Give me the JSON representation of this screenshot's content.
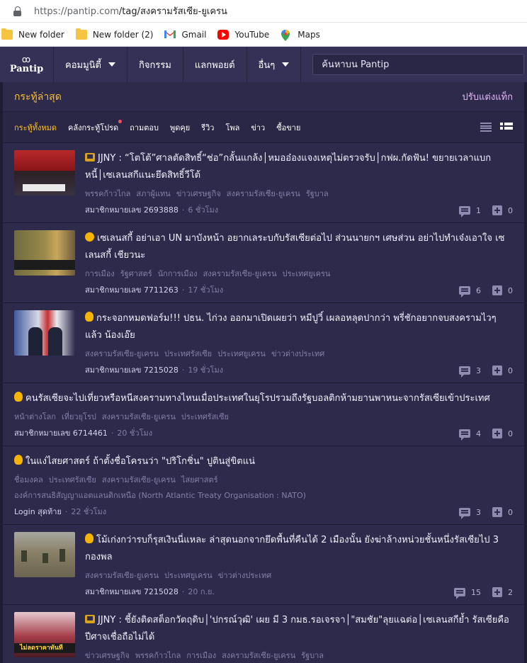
{
  "browser": {
    "url_base": "https://pantip.com",
    "url_path": "/tag/สงครามรัสเซีย-ยูเครน",
    "bookmarks": [
      {
        "label": "New folder",
        "icon": "folder-icon"
      },
      {
        "label": "New folder (2)",
        "icon": "folder-icon"
      },
      {
        "label": "Gmail",
        "icon": "gmail-icon"
      },
      {
        "label": "YouTube",
        "icon": "youtube-icon"
      },
      {
        "label": "Maps",
        "icon": "maps-icon"
      }
    ]
  },
  "nav": {
    "logo_text": "Pantip",
    "logo_mark": "ꝏ",
    "items": [
      {
        "label": "คอมมูนิตี้",
        "has_caret": true
      },
      {
        "label": "กิจกรรม",
        "has_caret": false
      },
      {
        "label": "แลกพอยต์",
        "has_caret": false
      },
      {
        "label": "อื่นๆ",
        "has_caret": true
      }
    ],
    "search_placeholder": "ค้นหาบน Pantip"
  },
  "section": {
    "title": "กระทู้ล่าสุด",
    "customize_label": "ปรับแต่งแท็ก"
  },
  "filters": [
    {
      "label": "กระทู้ทั้งหมด",
      "active": true,
      "dot": false
    },
    {
      "label": "คลังกระทู้โปรด",
      "active": false,
      "dot": true
    },
    {
      "label": "ถามตอบ",
      "active": false,
      "dot": false
    },
    {
      "label": "พูดคุย",
      "active": false,
      "dot": false
    },
    {
      "label": "รีวิว",
      "active": false,
      "dot": false
    },
    {
      "label": "โพล",
      "active": false,
      "dot": false
    },
    {
      "label": "ข่าว",
      "active": false,
      "dot": false
    },
    {
      "label": "ซื้อขาย",
      "active": false,
      "dot": false
    }
  ],
  "threads": [
    {
      "emoji": "tv",
      "thumb": "th1",
      "title": "JJNY : “โตโต้”ศาลตัดสิทธิ์“ช่อ”กลั้นแกล้ง│หมออ๋องแจงเหตุไม่ตรวจรับ│กฟผ.กัดฟัน! ขยายเวลาแบกหนี้│เซเลนสกีแนะยึดสิทธิ์วีโต้",
      "tags": [
        "พรรคก้าวไกล",
        "สภาผู้แทน",
        "ข่าวเศรษฐกิจ",
        "สงครามรัสเซีย-ยูเครน",
        "รัฐบาล"
      ],
      "author": "สมาชิกหมายเลข 2693888",
      "time": "6 ชั่วโมง",
      "comments": "1",
      "votes": "0"
    },
    {
      "emoji": "face",
      "thumb": "th2",
      "title": "เซเลนสกี้ อย่าเอา UN มาบังหน้า อยากเลระบกับรัสเซียต่อไป ส่วนนายกฯ เศษส่วน อย่าไปทำเจ๋งเอาใจ เซเลนสกี้ เชียวนะ",
      "tags": [
        "การเมือง",
        "รัฐศาสตร์",
        "นักการเมือง",
        "สงครามรัสเซีย-ยูเครน",
        "ประเทศยูเครน"
      ],
      "author": "สมาชิกหมายเลข 7711263",
      "time": "17 ชั่วโมง",
      "comments": "6",
      "votes": "0"
    },
    {
      "emoji": "bulb",
      "thumb": "th3",
      "title": "กระจอกหมดฟอร์ม!!! ปธน. ไก่วง ออกมาเปิดเผยว่า หมีปูวิ์ เผลอหลุดปากว่า พรี่ชักอยากจบสงครามไวๆ แล้ว น้องเอ๊ย",
      "tags": [
        "สงครามรัสเซีย-ยูเครน",
        "ประเทศรัสเซีย",
        "ประเทศยูเครน",
        "ข่าวต่างประเทศ"
      ],
      "author": "สมาชิกหมายเลข 7215028",
      "time": "19 ชั่วโมง",
      "comments": "3",
      "votes": "0"
    },
    {
      "emoji": "bulb",
      "thumb": "",
      "title": "คนรัสเซียจะไปเที่ยวหรือหนีสงครามทางไหนเมื่อประเทศในยุโรปรวมถึงรัฐบอลติกห้ามยานพาหนะจากรัสเซียเข้าประเทศ",
      "tags": [
        "หน้าต่างโลก",
        "เที่ยวยุโรป",
        "สงครามรัสเซีย-ยูเครน",
        "ประเทศรัสเซีย"
      ],
      "author": "สมาชิกหมายเลข 6714461",
      "time": "20 ชั่วโมง",
      "comments": "4",
      "votes": "0"
    },
    {
      "emoji": "bulb",
      "thumb": "",
      "title": "ในแง่ไสยศาสตร์ ถ้าตั้งชื่อโครนว่า \"ปริโกชิ่น\" ปูตินสู่ขิตแน่",
      "tags": [
        "ชื่อมงคล",
        "ประเทศรัสเซีย",
        "สงครามรัสเซีย-ยูเครน",
        "ไสยศาสตร์",
        "องค์การสนธิสัญญาแอตแลนติกเหนือ (North Atlantic Treaty Organisation : NATO)"
      ],
      "author": "Login สุดท้าย",
      "time": "22 ชั่วโมง",
      "comments": "3",
      "votes": "0"
    },
    {
      "emoji": "bulb",
      "thumb": "th6",
      "title": "โม้เก่งกว่ารบก็รุสเงินนี่แหละ ล่าสุดนอกจากยึดพื้นที่คืนได้ 2 เมืองนั้น ยังฆ่าล้างหน่วยชั้นหนึ่งรัสเซียไป 3 กองพล",
      "tags": [
        "สงครามรัสเซีย-ยูเครน",
        "ประเทศยูเครน",
        "ข่าวต่างประเทศ"
      ],
      "author": "สมาชิกหมายเลข 7215028",
      "time": "20 ก.ย.",
      "comments": "15",
      "votes": "2"
    },
    {
      "emoji": "tv",
      "thumb": "th7",
      "thumb_text": "ไม่ลดราคาทันที",
      "title": "JJNY : ชี้ยังติดสต็อกวัตถุดิบ│'ปกรณ์วุฒิ' เผย มี 3 กมธ.รอเจรจา│\"สมชัย\"ลุยแฉต่อ│เซเลนสกีย้ำ รัสเซียคือปีศาจเชื่อถือไม่ได้",
      "tags": [
        "ข่าวเศรษฐกิจ",
        "พรรคก้าวไกล",
        "การเมือง",
        "สงครามรัสเซีย-ยูเครน",
        "รัฐบาล"
      ],
      "author": "สมาชิกหมายเลข 3837652",
      "time": "20 ก.ย.",
      "comments": "2",
      "votes": "0"
    }
  ]
}
